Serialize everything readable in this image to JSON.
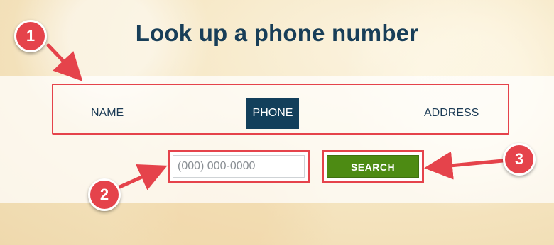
{
  "page": {
    "title": "Look up a phone number"
  },
  "tabs": [
    {
      "label": "NAME",
      "selected": false
    },
    {
      "label": "PHONE",
      "selected": true
    },
    {
      "label": "ADDRESS",
      "selected": false
    }
  ],
  "search": {
    "placeholder": "(000) 000-0000",
    "value": "",
    "button_label": "SEARCH"
  },
  "annotations": {
    "callout_1": "1",
    "callout_2": "2",
    "callout_3": "3",
    "color": "#e5434b"
  },
  "colors": {
    "title": "#183e58",
    "selected_tab_bg": "#123f5b",
    "search_button": "#4d8b13"
  }
}
